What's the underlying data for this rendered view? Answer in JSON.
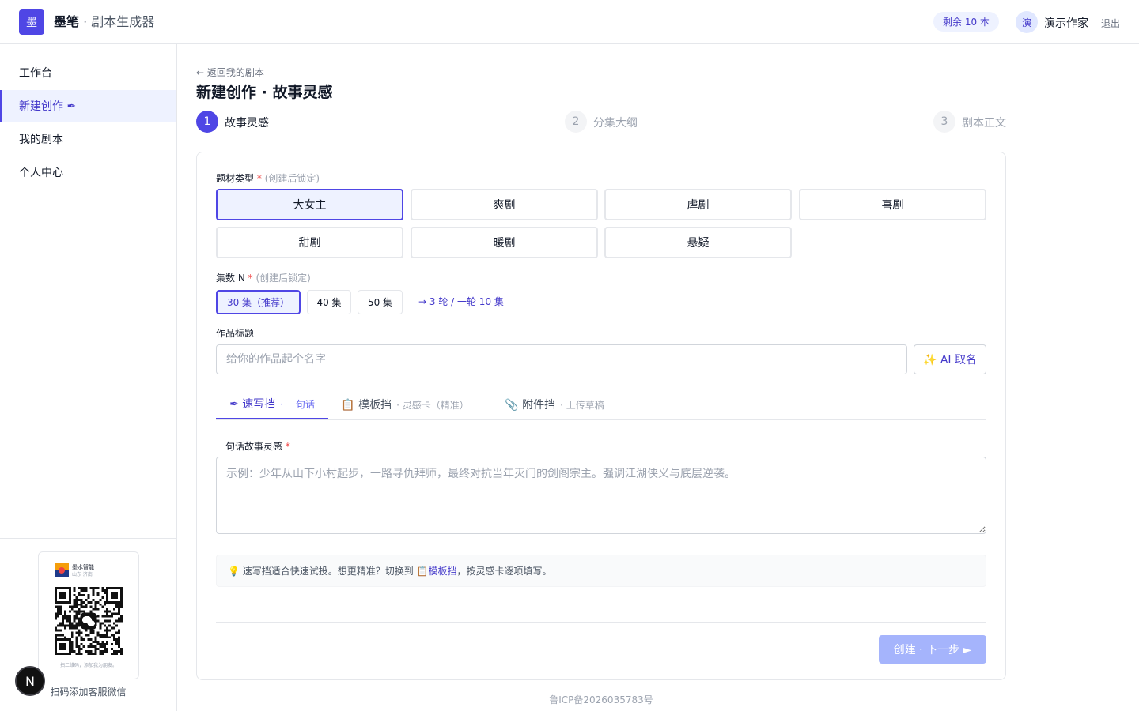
{
  "header": {
    "logo_char": "墨",
    "brand_name": "墨笔",
    "brand_sep": " · ",
    "brand_sub": "剧本生成器",
    "quota": "剩余 10 本",
    "avatar_char": "演",
    "username": "演示作家",
    "logout": "退出"
  },
  "sidebar": {
    "items": [
      {
        "label": "工作台"
      },
      {
        "label": "新建创作 ✒"
      },
      {
        "label": "我的剧本"
      },
      {
        "label": "个人中心"
      }
    ],
    "qr_card": {
      "mini_title": "墨水智能",
      "mini_sub": "山东 济南",
      "hint": "扫二维码，添加我为朋友。"
    },
    "qr_caption": "扫码添加客服微信",
    "badge": "N"
  },
  "main": {
    "back_link": "← 返回我的剧本",
    "title": "新建创作 · 故事灵感",
    "steps": [
      {
        "num": "1",
        "label": "故事灵感"
      },
      {
        "num": "2",
        "label": "分集大纲"
      },
      {
        "num": "3",
        "label": "剧本正文"
      }
    ],
    "genre": {
      "label": "题材类型",
      "req": "*",
      "note": "(创建后锁定)",
      "options": [
        "大女主",
        "爽剧",
        "虐剧",
        "喜剧",
        "甜剧",
        "暖剧",
        "悬疑"
      ],
      "selected": "大女主"
    },
    "episodes": {
      "label": "集数 N",
      "req": "*",
      "note": "(创建后锁定)",
      "options": [
        "30 集（推荐）",
        "40 集",
        "50 集"
      ],
      "selected": "30 集（推荐）",
      "hint": "→ 3 轮 / 一轮 10 集"
    },
    "work_title": {
      "label": "作品标题",
      "value": "",
      "placeholder": "给你的作品起个名字",
      "ai_button": "✨ AI 取名"
    },
    "tabs": [
      {
        "label": "✒ 速写挡",
        "sub": "· 一句话"
      },
      {
        "label": "📋 模板挡",
        "sub": "· 灵感卡（精准）"
      },
      {
        "label": "📎 附件挡",
        "sub": "· 上传草稿"
      }
    ],
    "active_tab": "速写挡",
    "story": {
      "label": "一句话故事灵感",
      "req": "*",
      "value": "",
      "placeholder": "示例：少年从山下小村起步，一路寻仇拜师，最终对抗当年灭门的剑阁宗主。强调江湖侠义与底层逆袭。"
    },
    "tip": {
      "text_before": "💡 速写挡适合快速试投。想更精准？切换到 📋 ",
      "link": "模板挡",
      "text_after": "，按灵感卡逐项填写。"
    },
    "next_button": "创建 · 下一步 ►"
  },
  "footer": {
    "icp": "鲁ICP备2026035783号"
  },
  "colors": {
    "accent": "#4f46e5",
    "accent_light": "#eef2ff",
    "accent_text": "#4338ca",
    "required": "#ef4444",
    "next_disabled": "#a5b4fc"
  },
  "icons": [
    "nib-icon",
    "clipboard-icon",
    "paperclip-icon",
    "bulb-icon",
    "sparkles-icon",
    "arrow-left-icon",
    "arrow-right-icon",
    "wechat-icon"
  ]
}
